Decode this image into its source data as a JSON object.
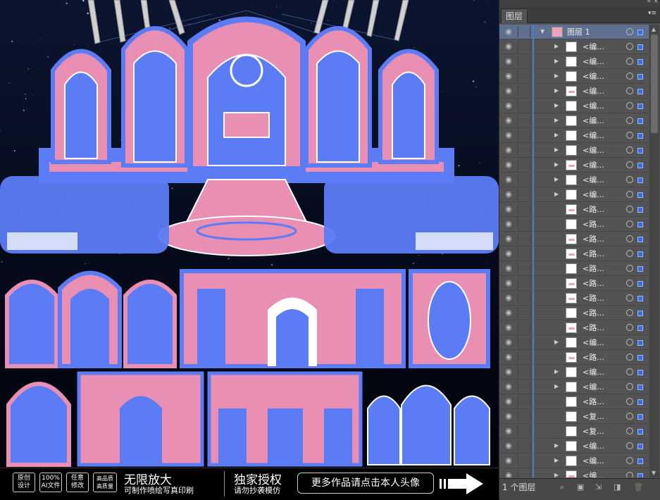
{
  "banner": {
    "badge1": "原创\n设计",
    "badge2": "100%\nAI文件",
    "badge3": "任意\n修改",
    "badge4": "高品质\n高质量",
    "headline1": "无限放大",
    "sub1": "可制作喷绘写真印刷",
    "headline2": "独家授权",
    "sub2": "请勿抄袭模仿",
    "cta": "更多作品请点击本人头像",
    "arrow_icon": "right-arrow-icon"
  },
  "panel": {
    "tab_label": "图层",
    "collapse_icon": "double-chevron-icon",
    "menu_icon": "panel-menu-icon",
    "layer_count": "1 个图层",
    "footer_icons": [
      "search-icon",
      "make-clip-mask-icon",
      "new-sublayer-icon",
      "new-layer-icon",
      "delete-icon"
    ]
  },
  "layers": [
    {
      "name": "图层 1",
      "expanded": true,
      "level": 0,
      "thumb": "artwork"
    },
    {
      "name": "<编...",
      "expanded": false,
      "level": 1,
      "thumb": "blank"
    },
    {
      "name": "<编...",
      "expanded": false,
      "level": 1,
      "thumb": "blank"
    },
    {
      "name": "<编...",
      "expanded": false,
      "level": 1,
      "thumb": "blank"
    },
    {
      "name": "<编...",
      "expanded": false,
      "level": 1,
      "thumb": "mark"
    },
    {
      "name": "<编...",
      "expanded": false,
      "level": 1,
      "thumb": "blank"
    },
    {
      "name": "<编...",
      "expanded": false,
      "level": 1,
      "thumb": "blank"
    },
    {
      "name": "<编...",
      "expanded": false,
      "level": 1,
      "thumb": "blank"
    },
    {
      "name": "<编...",
      "expanded": false,
      "level": 1,
      "thumb": "blank"
    },
    {
      "name": "<编...",
      "expanded": false,
      "level": 1,
      "thumb": "mark"
    },
    {
      "name": "<编...",
      "expanded": false,
      "level": 1,
      "thumb": "blank"
    },
    {
      "name": "<编...",
      "expanded": false,
      "level": 1,
      "thumb": "blank"
    },
    {
      "name": "<路...",
      "expanded": null,
      "level": 1,
      "thumb": "mark"
    },
    {
      "name": "<路...",
      "expanded": null,
      "level": 1,
      "thumb": "blank"
    },
    {
      "name": "<路...",
      "expanded": null,
      "level": 1,
      "thumb": "mark"
    },
    {
      "name": "<路...",
      "expanded": null,
      "level": 1,
      "thumb": "mark"
    },
    {
      "name": "<路...",
      "expanded": null,
      "level": 1,
      "thumb": "blank"
    },
    {
      "name": "<路...",
      "expanded": null,
      "level": 1,
      "thumb": "mark"
    },
    {
      "name": "<路...",
      "expanded": null,
      "level": 1,
      "thumb": "mark"
    },
    {
      "name": "<路...",
      "expanded": null,
      "level": 1,
      "thumb": "blank"
    },
    {
      "name": "<路...",
      "expanded": null,
      "level": 1,
      "thumb": "mark"
    },
    {
      "name": "<编...",
      "expanded": false,
      "level": 1,
      "thumb": "blank"
    },
    {
      "name": "<路...",
      "expanded": null,
      "level": 1,
      "thumb": "mark"
    },
    {
      "name": "<编...",
      "expanded": false,
      "level": 1,
      "thumb": "blank"
    },
    {
      "name": "<编...",
      "expanded": false,
      "level": 1,
      "thumb": "blank"
    },
    {
      "name": "<路...",
      "expanded": null,
      "level": 1,
      "thumb": "blank"
    },
    {
      "name": "<复...",
      "expanded": null,
      "level": 1,
      "thumb": "blank"
    },
    {
      "name": "<复...",
      "expanded": null,
      "level": 1,
      "thumb": "blank"
    },
    {
      "name": "<编...",
      "expanded": false,
      "level": 1,
      "thumb": "blank"
    },
    {
      "name": "<编...",
      "expanded": false,
      "level": 1,
      "thumb": "blank"
    },
    {
      "name": "<编...",
      "expanded": false,
      "level": 1,
      "thumb": "mark"
    }
  ],
  "colors": {
    "pink": "#e98fb4",
    "blue": "#5b7cf5",
    "white": "#ffffff",
    "night": "#05060f",
    "panel": "#535353",
    "selection_blue": "#3b6de0"
  }
}
